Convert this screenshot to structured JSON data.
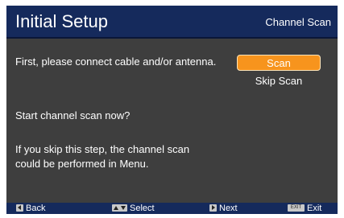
{
  "header": {
    "title": "Initial Setup",
    "subtitle": "Channel Scan"
  },
  "messages": {
    "connect": "First, please connect cable and/or antenna.",
    "prompt": "Start channel scan now?",
    "skip_note": "If you skip this step, the channel scan could be performed in Menu."
  },
  "options": {
    "scan": "Scan",
    "skip": "Skip Scan",
    "selected": "Scan"
  },
  "footer": {
    "back": "Back",
    "select": "Select",
    "next": "Next",
    "exit_key": "EXIT",
    "exit": "Exit"
  },
  "colors": {
    "header_bg": "#152a5c",
    "panel_bg": "#3e3e3e",
    "accent": "#f7941d"
  }
}
